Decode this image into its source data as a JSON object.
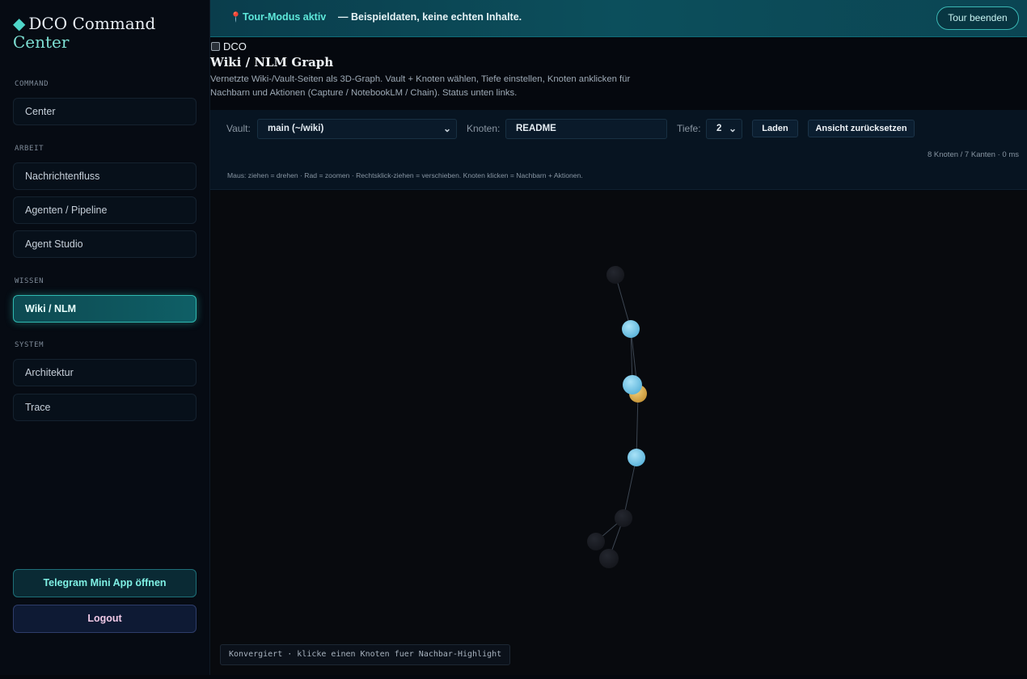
{
  "app": {
    "brand_diamond": "◆",
    "brand_line1": "DCO Command",
    "brand_line2": "Center"
  },
  "sidebar": {
    "sections": [
      {
        "label": "COMMAND",
        "items": [
          {
            "label": "Center"
          }
        ]
      },
      {
        "label": "ARBEIT",
        "items": [
          {
            "label": "Nachrichtenfluss"
          },
          {
            "label": "Agenten / Pipeline"
          },
          {
            "label": "Agent Studio"
          }
        ]
      },
      {
        "label": "WISSEN",
        "items": [
          {
            "label": "Wiki / NLM",
            "active": true
          }
        ]
      },
      {
        "label": "SYSTEM",
        "items": [
          {
            "label": "Architektur"
          },
          {
            "label": "Trace"
          }
        ]
      }
    ],
    "telegram_button": "Telegram Mini App öffnen",
    "logout_button": "Logout"
  },
  "banner": {
    "pin_icon": "📍",
    "mode": "Tour-Modus aktiv",
    "message": "— Beispieldaten, keine echten Inhalte.",
    "end_button": "Tour beenden"
  },
  "header": {
    "breadcrumb": "DCO",
    "title": "Wiki / NLM Graph",
    "description": "Vernetzte Wiki-/Vault-Seiten als 3D-Graph. Vault + Knoten wählen, Tiefe einstellen, Knoten anklicken für Nachbarn und Aktionen (Capture / NotebookLM / Chain). Status unten links."
  },
  "toolbar": {
    "vault_label": "Vault:",
    "vault_value": "main (~/wiki)",
    "node_label": "Knoten:",
    "node_value": "README",
    "depth_label": "Tiefe:",
    "depth_value": "2",
    "load_button": "Laden",
    "reset_button": "Ansicht zurücksetzen",
    "stats": "8 Knoten / 7 Kanten · 0 ms",
    "hint": "Maus: ziehen = drehen · Rad = zoomen · Rechtsklick-ziehen = verschieben. Knoten klicken = Nachbarn + Aktionen."
  },
  "graph": {
    "colors": {
      "dim": "#1a1c22",
      "highlight": "#7cc8e8",
      "selected": "#e2b55a"
    },
    "nodes": [
      {
        "id": "n1",
        "state": "dim"
      },
      {
        "id": "n2",
        "state": "highlight"
      },
      {
        "id": "n3",
        "state": "selected"
      },
      {
        "id": "n4",
        "state": "highlight"
      },
      {
        "id": "n5",
        "state": "highlight"
      },
      {
        "id": "n6",
        "state": "dim"
      },
      {
        "id": "n7",
        "state": "dim"
      },
      {
        "id": "n8",
        "state": "dim"
      }
    ]
  },
  "status": "Konvergiert · klicke einen Knoten fuer Nachbar-Highlight"
}
